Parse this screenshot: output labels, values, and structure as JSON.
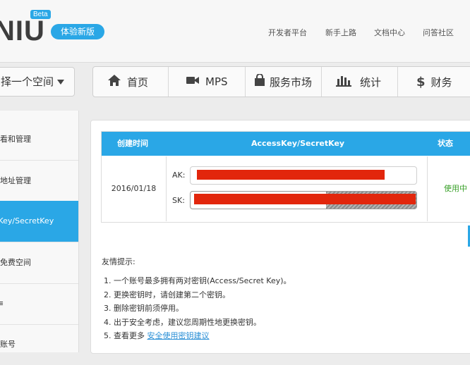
{
  "header": {
    "logo": "NIU",
    "beta": "Beta",
    "new_version_button": "体验新版",
    "links": [
      "开发者平台",
      "新手上路",
      "文档中心",
      "问答社区"
    ]
  },
  "nav": {
    "space_select": "择一个空间",
    "items": [
      {
        "label": "首页",
        "icon": "home-icon"
      },
      {
        "label": "MPS",
        "icon": "video-camera-icon"
      },
      {
        "label": "服务市场",
        "icon": "shopping-bag-icon"
      },
      {
        "label": "统计",
        "icon": "bar-chart-icon"
      },
      {
        "label": "财务",
        "icon": "dollar-icon"
      }
    ]
  },
  "sidebar": {
    "items": [
      {
        "label": "看和管理",
        "active": false
      },
      {
        "label": "地址管理",
        "active": false
      },
      {
        "label": "ssKey/SecretKey",
        "active": true
      },
      {
        "label": "免费空间",
        "active": false
      },
      {
        "label": "≡",
        "active": false
      },
      {
        "label": "账号",
        "active": false
      }
    ]
  },
  "keys_table": {
    "headers": [
      "创建时间",
      "AccessKey/SecretKey",
      "状态"
    ],
    "rows": [
      {
        "date": "2016/01/18",
        "ak_label": "AK:",
        "sk_label": "SK:",
        "status": "使用中"
      }
    ]
  },
  "tips": {
    "title": "友情提示:",
    "items": [
      "1.  一个账号最多拥有两对密钥(Access/Secret Key)。",
      "2.  更换密钥时，请创建第二个密钥。",
      "3.  删除密钥前须停用。",
      "4.  出于安全考虑，建议您周期性地更换密钥。"
    ],
    "last_prefix": "5.  查看更多",
    "last_link": "安全使用密钥建议"
  },
  "colors": {
    "accent": "#2aa7e6",
    "status_green": "#3aa12a",
    "redaction": "#e2260c",
    "link": "#2a8fd6"
  }
}
